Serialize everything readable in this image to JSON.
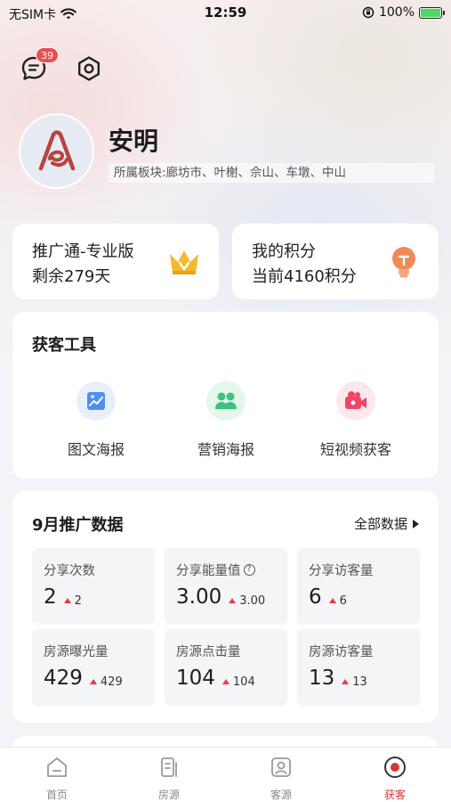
{
  "status_bar": {
    "carrier": "无SIM卡",
    "time": "12:59",
    "battery": "100%"
  },
  "header": {
    "message_badge": "39"
  },
  "profile": {
    "name": "安明",
    "region": "所属板块:廊坊市、叶榭、佘山、车墩、中山"
  },
  "cards": {
    "promo": {
      "title": "推广通-专业版",
      "remaining": "剩余279天"
    },
    "points": {
      "title": "我的积分",
      "current": "当前4160积分"
    }
  },
  "tools": {
    "title": "获客工具",
    "items": [
      {
        "label": "图文海报",
        "icon": "image-poster-icon"
      },
      {
        "label": "营销海报",
        "icon": "people-icon"
      },
      {
        "label": "短视频获客",
        "icon": "video-camera-icon"
      }
    ]
  },
  "promo_data": {
    "title": "9月推广数据",
    "all_label": "全部数据",
    "metrics": [
      {
        "label": "分享次数",
        "value": "2",
        "delta": "2"
      },
      {
        "label": "分享能量值",
        "value": "3.00",
        "delta": "3.00",
        "help": "?"
      },
      {
        "label": "分享访客量",
        "value": "6",
        "delta": "6"
      },
      {
        "label": "房源曝光量",
        "value": "429",
        "delta": "429"
      },
      {
        "label": "房源点击量",
        "value": "104",
        "delta": "104"
      },
      {
        "label": "房源访客量",
        "value": "13",
        "delta": "13"
      }
    ]
  },
  "tabbar": {
    "items": [
      {
        "label": "首页",
        "active": false
      },
      {
        "label": "房源",
        "active": false
      },
      {
        "label": "客源",
        "active": false
      },
      {
        "label": "获客",
        "active": true
      }
    ]
  },
  "colors": {
    "accent_red": "#d93535",
    "badge_red": "#f04e4e",
    "crown_gold": "#f5b82e",
    "bulb_orange": "#f08a55"
  }
}
